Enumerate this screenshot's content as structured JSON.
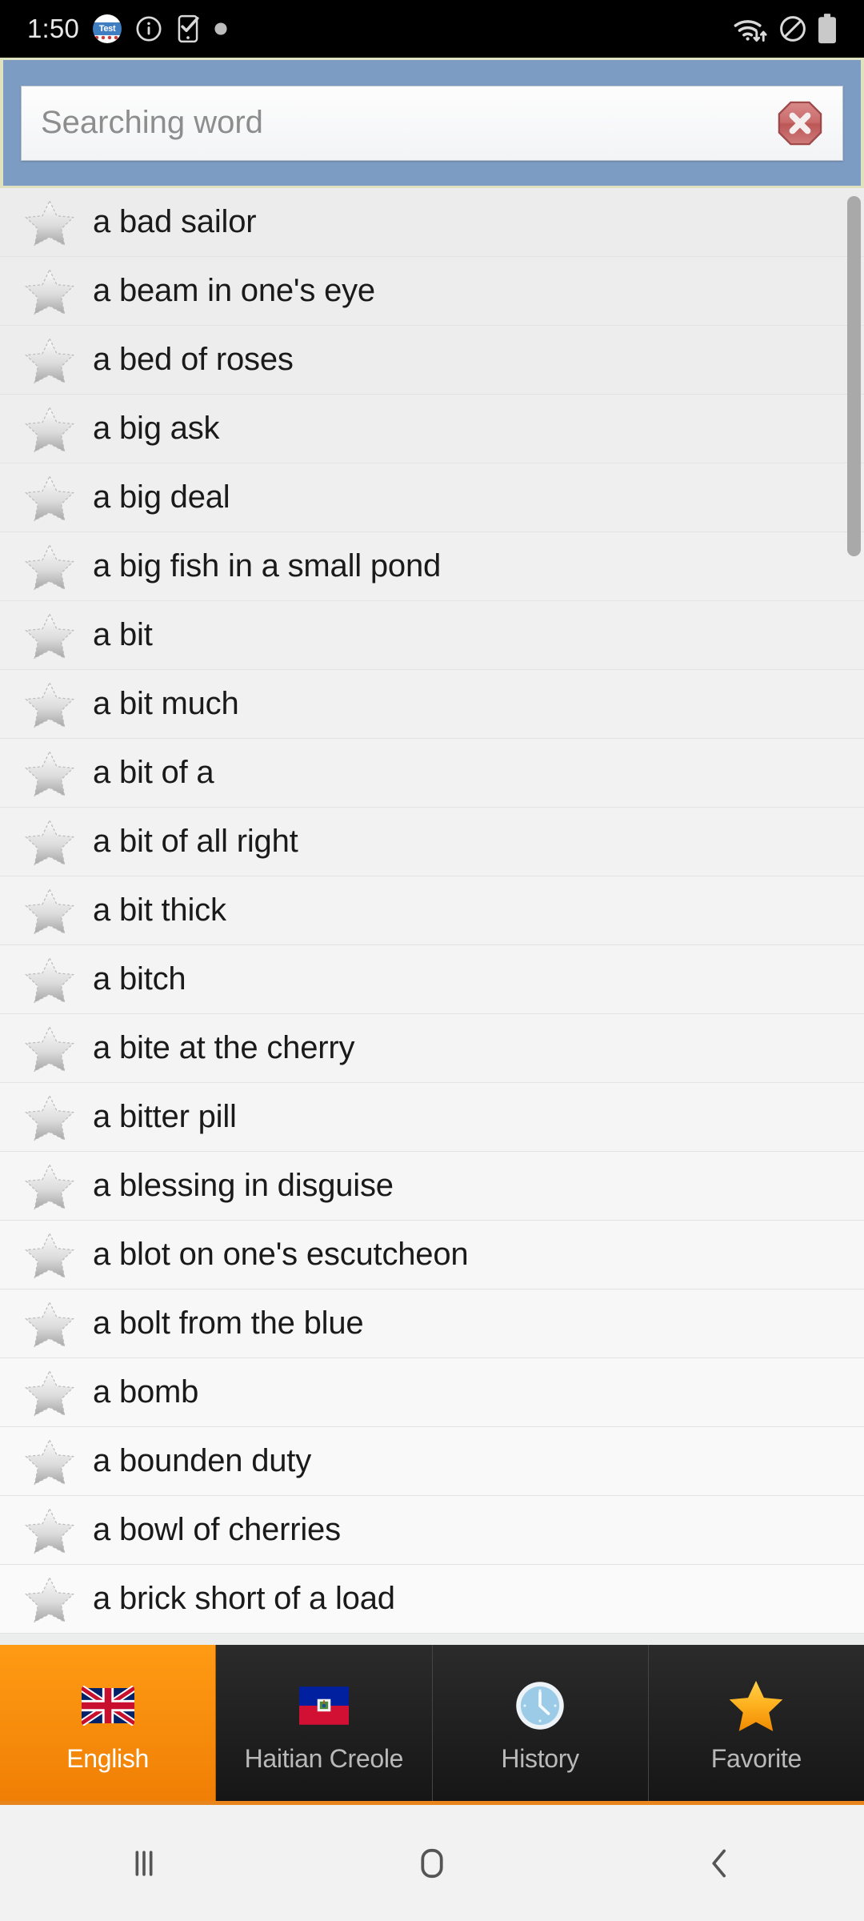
{
  "status_bar": {
    "time": "1:50",
    "app_badge_label": "Test",
    "icons_left": [
      "app-badge-test-icon",
      "info-icon",
      "phone-check-icon",
      "dot-icon"
    ],
    "icons_right": [
      "wifi-data-icon",
      "do-not-disturb-icon",
      "battery-full-icon"
    ],
    "background_color": "#000000"
  },
  "search": {
    "placeholder": "Searching word",
    "value": "",
    "clear_icon": "clear-octagon-icon",
    "header_color": "#7d9cc3",
    "border_color": "#dfe2bf",
    "clear_button_color": "#c05b5b"
  },
  "word_list": {
    "star_icon": "favorite-star-outline-icon",
    "items": [
      {
        "word": "a bad sailor"
      },
      {
        "word": "a beam in one's eye"
      },
      {
        "word": "a bed of roses"
      },
      {
        "word": "a big ask"
      },
      {
        "word": "a big deal"
      },
      {
        "word": "a big fish in a small pond"
      },
      {
        "word": "a bit"
      },
      {
        "word": "a bit much"
      },
      {
        "word": "a bit of a"
      },
      {
        "word": "a bit of all right"
      },
      {
        "word": "a bit thick"
      },
      {
        "word": "a bitch"
      },
      {
        "word": "a bite at the cherry"
      },
      {
        "word": "a bitter pill"
      },
      {
        "word": "a blessing in disguise"
      },
      {
        "word": "a blot on one's escutcheon"
      },
      {
        "word": "a bolt from the blue"
      },
      {
        "word": "a bomb"
      },
      {
        "word": "a bounden duty"
      },
      {
        "word": "a bowl of cherries"
      },
      {
        "word": "a brick short of a load"
      }
    ]
  },
  "tab_bar": {
    "active_index": 0,
    "active_color": "#f58a0b",
    "tabs": [
      {
        "label": "English",
        "icon": "uk-flag-icon"
      },
      {
        "label": "Haitian Creole",
        "icon": "haiti-flag-icon"
      },
      {
        "label": "History",
        "icon": "clock-icon"
      },
      {
        "label": "Favorite",
        "icon": "star-gold-icon"
      }
    ]
  },
  "nav_bar": {
    "buttons": [
      {
        "name": "recents",
        "icon": "recents-icon"
      },
      {
        "name": "home",
        "icon": "home-icon"
      },
      {
        "name": "back",
        "icon": "back-icon"
      }
    ]
  }
}
